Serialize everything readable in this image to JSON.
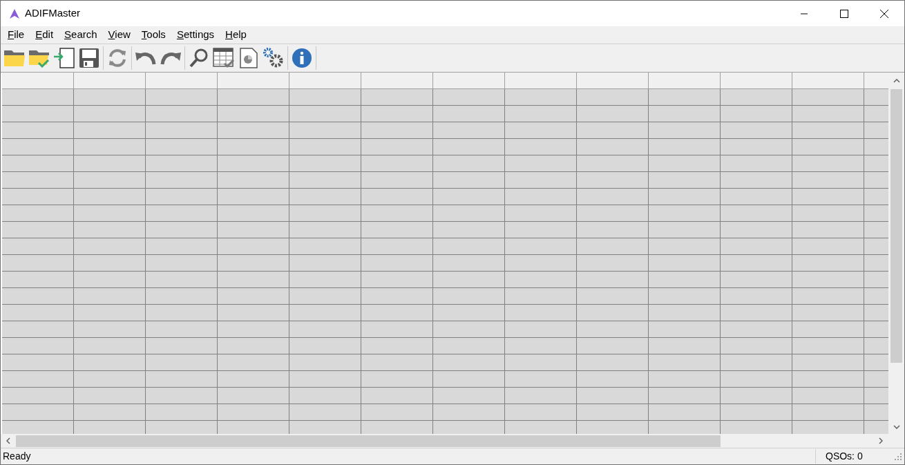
{
  "window": {
    "title": "ADIFMaster"
  },
  "menu": [
    {
      "label": "File"
    },
    {
      "label": "Edit"
    },
    {
      "label": "Search"
    },
    {
      "label": "View"
    },
    {
      "label": "Tools"
    },
    {
      "label": "Settings"
    },
    {
      "label": "Help"
    }
  ],
  "status_bar": {
    "message": "Ready",
    "qso_count": "QSOs: 0"
  }
}
